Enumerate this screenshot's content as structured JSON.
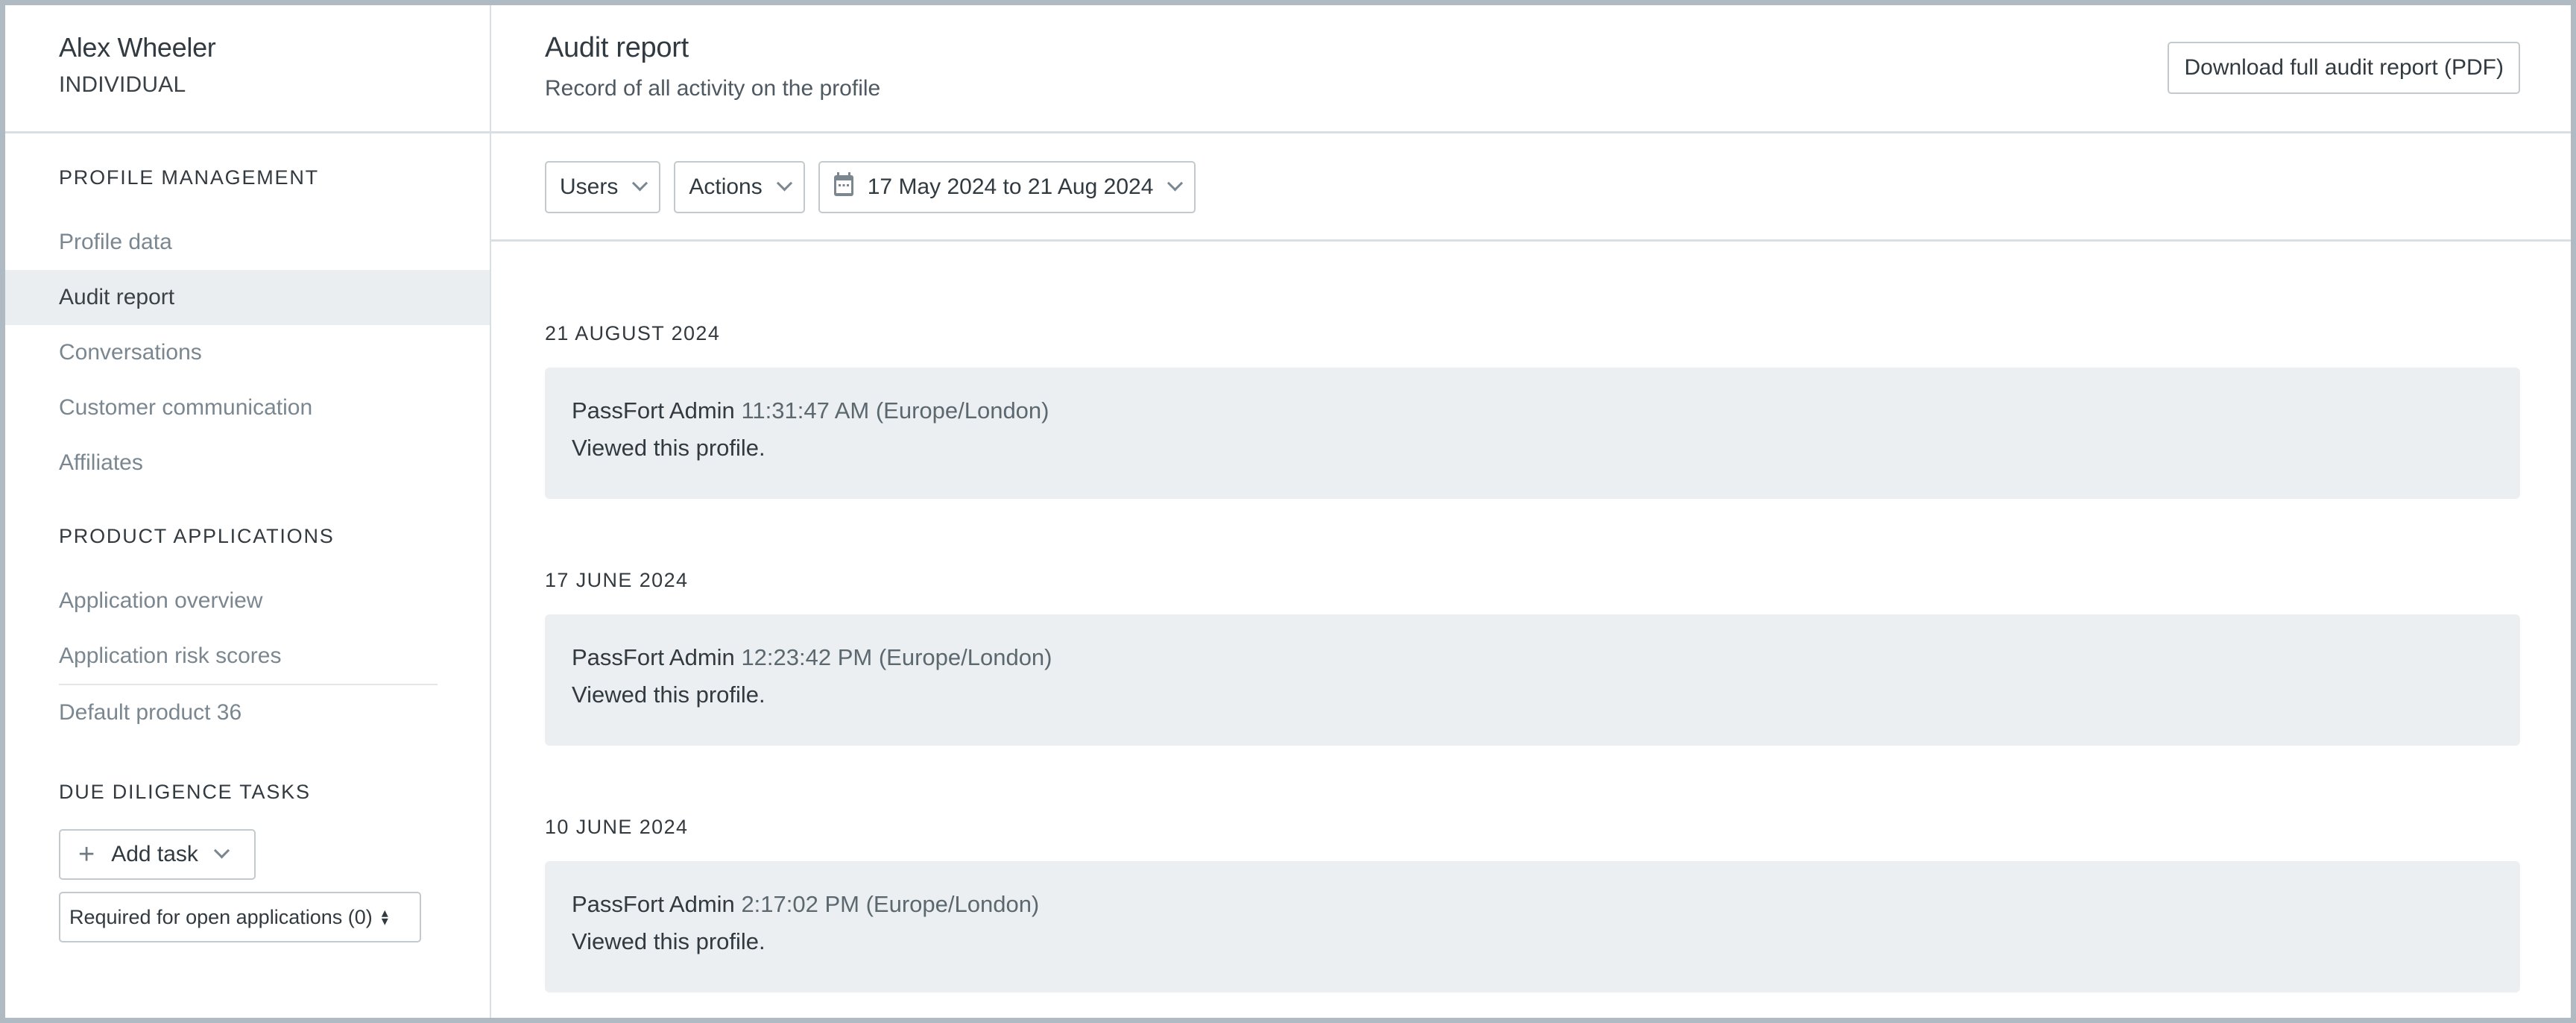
{
  "profile": {
    "name": "Alex Wheeler",
    "type": "INDIVIDUAL"
  },
  "sidebar": {
    "sections": [
      {
        "title": "PROFILE MANAGEMENT",
        "items": [
          {
            "label": "Profile data",
            "active": false
          },
          {
            "label": "Audit report",
            "active": true
          },
          {
            "label": "Conversations",
            "active": false
          },
          {
            "label": "Customer communication",
            "active": false
          },
          {
            "label": "Affiliates",
            "active": false
          }
        ]
      },
      {
        "title": "PRODUCT APPLICATIONS",
        "items": [
          {
            "label": "Application overview",
            "active": false
          },
          {
            "label": "Application risk scores",
            "active": false
          },
          {
            "label": "Default product 36",
            "active": false
          }
        ]
      }
    ],
    "due_diligence": {
      "title": "DUE DILIGENCE TASKS",
      "add_task_label": "Add task",
      "filter_select_value": "Required for open applications (0)"
    }
  },
  "header": {
    "title": "Audit report",
    "subtitle": "Record of all activity on the profile",
    "download_button": "Download full audit report (PDF)"
  },
  "filters": {
    "users_label": "Users",
    "actions_label": "Actions",
    "date_range_label": "17 May 2024 to 21 Aug 2024"
  },
  "entries": [
    {
      "date": "21 AUGUST 2024",
      "user": "PassFort Admin",
      "time": "11:31:47 AM (Europe/London)",
      "action": "Viewed this profile."
    },
    {
      "date": "17 JUNE 2024",
      "user": "PassFort Admin",
      "time": "12:23:42 PM (Europe/London)",
      "action": "Viewed this profile."
    },
    {
      "date": "10 JUNE 2024",
      "user": "PassFort Admin",
      "time": "2:17:02 PM (Europe/London)",
      "action": "Viewed this profile."
    }
  ],
  "colors": {
    "frame_border": "#b0bac2",
    "active_nav_bg": "#ebeef0",
    "entry_bg": "#eceff1",
    "muted_text": "#7a8790",
    "primary_text": "#313a40"
  }
}
